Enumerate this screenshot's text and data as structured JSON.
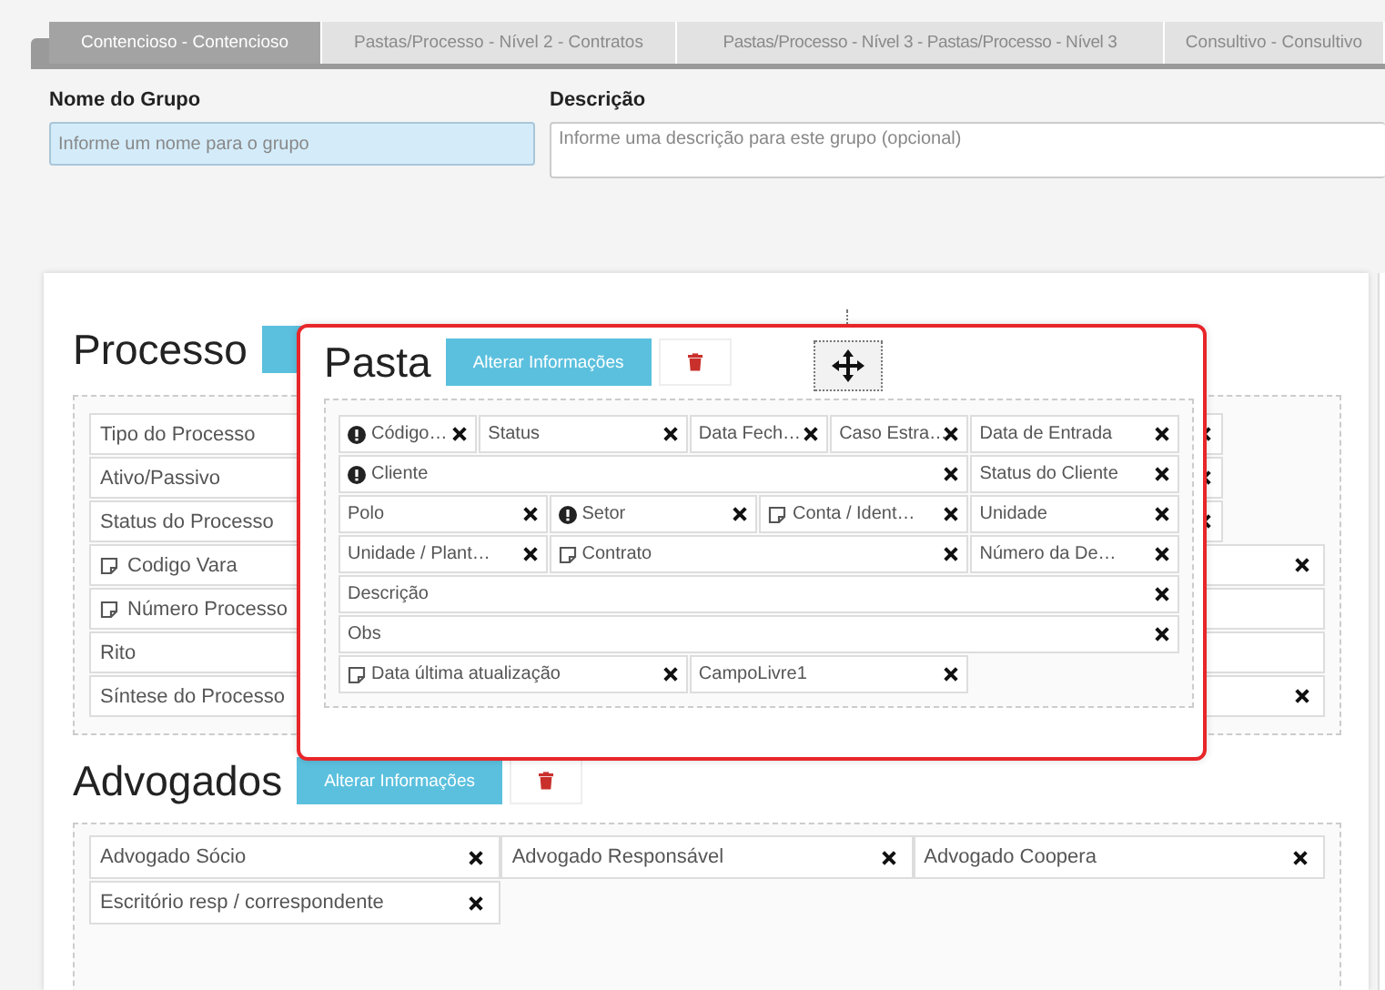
{
  "tabs": [
    {
      "label": "Contencioso - Contencioso",
      "selected": true
    },
    {
      "label": "Pastas/Processo - Nível 2 - Contratos",
      "selected": false
    },
    {
      "label": "Pastas/Processo - Nível 3 - Pastas/Processo - Nível 3",
      "selected": false
    },
    {
      "label": "Consultivo - Consultivo",
      "selected": false
    }
  ],
  "form": [
    {
      "label": "Nome do Grupo",
      "placeholder": "Informe um nome para o grupo",
      "kind": "input"
    },
    {
      "label": "Descrição",
      "placeholder": "Informe uma descrição para este grupo (opcional)",
      "kind": "textarea"
    }
  ],
  "processo": {
    "title": "Processo",
    "rows": [
      [
        {
          "label": "Tipo do Processo",
          "kind": "plain",
          "removable": true
        }
      ],
      [
        {
          "label": "Ativo/Passivo",
          "kind": "plain",
          "removable": true
        }
      ],
      [
        {
          "label": "Status do Processo",
          "kind": "plain",
          "removable": true
        }
      ],
      [
        {
          "label": "Codigo Vara",
          "kind": "note",
          "removable": false
        },
        {
          "kind": "plain",
          "removable": true
        }
      ],
      [
        {
          "label": "Número Processo",
          "kind": "note",
          "removable": false
        }
      ],
      [
        {
          "label": "Rito",
          "kind": "plain",
          "removable": false
        }
      ],
      [
        {
          "label": "Síntese do Processo",
          "kind": "plain",
          "removable": false
        },
        {
          "kind": "plain",
          "removable": true
        }
      ]
    ]
  },
  "pasta": {
    "title": "Pasta",
    "button": "Alterar Informações",
    "fields": [
      {
        "label": "Código…",
        "kind": "info",
        "removable": true
      },
      {
        "label": "Status",
        "kind": "plain",
        "removable": true
      },
      {
        "label": "Data Fech…",
        "kind": "plain",
        "removable": true
      },
      {
        "label": "Caso Estra…",
        "kind": "plain",
        "removable": true
      },
      {
        "label": "Data de Entrada",
        "kind": "plain",
        "removable": true
      },
      {
        "label": "Cliente",
        "kind": "info",
        "removable": true
      },
      {
        "label": "Status do Cliente",
        "kind": "plain",
        "removable": true
      },
      {
        "label": "Polo",
        "kind": "plain",
        "removable": true
      },
      {
        "label": "Setor",
        "kind": "info",
        "removable": true
      },
      {
        "label": "Conta / Ident…",
        "kind": "note",
        "removable": true
      },
      {
        "label": "Unidade",
        "kind": "plain",
        "removable": true
      },
      {
        "label": "Unidade / Plant…",
        "kind": "plain",
        "removable": true
      },
      {
        "label": "Contrato",
        "kind": "note",
        "removable": true
      },
      {
        "label": "Número da De…",
        "kind": "plain",
        "removable": true
      },
      {
        "label": "Descrição",
        "kind": "plain",
        "removable": true
      },
      {
        "label": "Obs",
        "kind": "plain",
        "removable": true
      },
      {
        "label": "Data última atualização",
        "kind": "note",
        "removable": true
      },
      {
        "label": "CampoLivre1",
        "kind": "plain",
        "removable": true
      }
    ]
  },
  "advogados": {
    "title": "Advogados",
    "button": "Alterar Informações",
    "fields": [
      {
        "label": "Advogado Sócio",
        "removable": true
      },
      {
        "label": "Advogado Responsável",
        "removable": true
      },
      {
        "label": "Advogado Coopera",
        "removable": true
      },
      {
        "label": "Escritório resp / correspondente",
        "removable": true
      }
    ]
  }
}
